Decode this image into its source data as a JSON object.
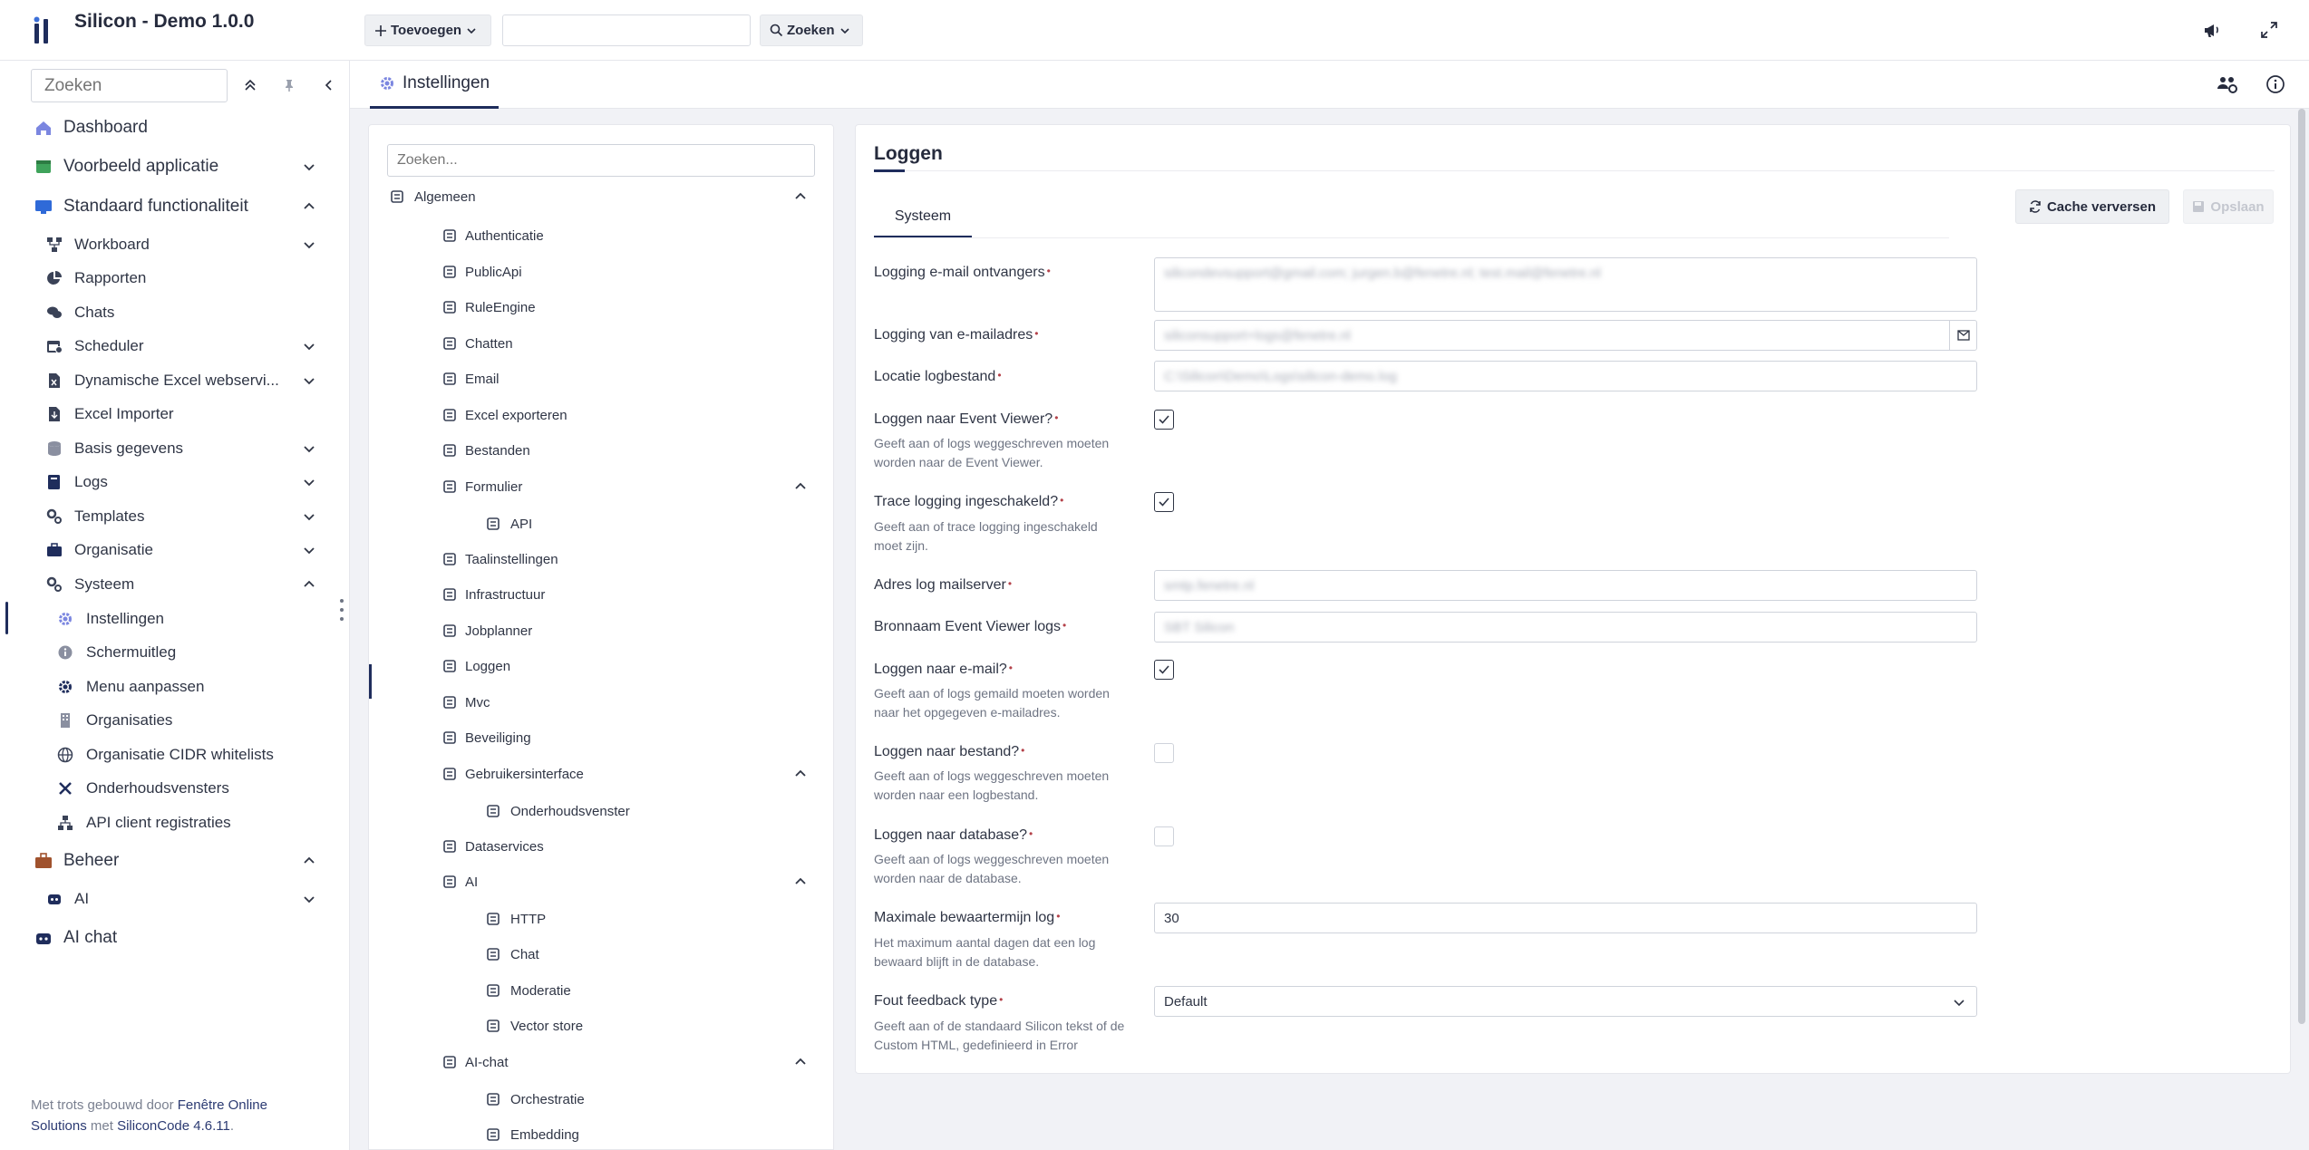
{
  "app": {
    "title": "Silicon - Demo 1.0.0"
  },
  "topbar": {
    "add_label": "Toevoegen",
    "search_label": "Zoeken",
    "search_value": ""
  },
  "sidebar": {
    "search_placeholder": "Zoeken",
    "items": [
      {
        "label": "Dashboard",
        "icon": "home-icon"
      },
      {
        "label": "Voorbeeld applicatie",
        "icon": "app-icon"
      },
      {
        "label": "Standaard functionaliteit",
        "icon": "monitor-icon"
      },
      {
        "label": "Workboard",
        "icon": "workflow-icon"
      },
      {
        "label": "Rapporten",
        "icon": "pie-chart-icon"
      },
      {
        "label": "Chats",
        "icon": "chat-icon"
      },
      {
        "label": "Scheduler",
        "icon": "calendar-icon"
      },
      {
        "label": "Dynamische Excel webservi...",
        "icon": "excel-icon"
      },
      {
        "label": "Excel Importer",
        "icon": "excel-import-icon"
      },
      {
        "label": "Basis gegevens",
        "icon": "database-icon"
      },
      {
        "label": "Logs",
        "icon": "book-icon"
      },
      {
        "label": "Templates",
        "icon": "templates-icon"
      },
      {
        "label": "Organisatie",
        "icon": "briefcase-icon"
      },
      {
        "label": "Systeem",
        "icon": "gears-icon"
      },
      {
        "label": "Instellingen",
        "icon": "gear-icon"
      },
      {
        "label": "Schermuitleg",
        "icon": "info-icon"
      },
      {
        "label": "Menu aanpassen",
        "icon": "gear-icon"
      },
      {
        "label": "Organisaties",
        "icon": "building-icon"
      },
      {
        "label": "Organisatie CIDR whitelists",
        "icon": "globe-icon"
      },
      {
        "label": "Onderhoudsvensters",
        "icon": "tools-icon"
      },
      {
        "label": "API client registraties",
        "icon": "sitemap-icon"
      },
      {
        "label": "Beheer",
        "icon": "briefcase-icon"
      },
      {
        "label": "AI",
        "icon": "robot-icon"
      },
      {
        "label": "AI chat",
        "icon": "robot-icon"
      }
    ],
    "footer": {
      "prefix": "Met trots gebouwd door ",
      "company": "Fenêtre Online Solutions",
      "middle": " met ",
      "product": "SiliconCode 4.6.11",
      "suffix": "."
    }
  },
  "page": {
    "tab_label": "Instellingen"
  },
  "tree": {
    "search_placeholder": "Zoeken...",
    "items": [
      {
        "label": "Algemeen",
        "icon": "list-icon"
      },
      {
        "label": "Authenticatie",
        "icon": "user-icon"
      },
      {
        "label": "PublicApi",
        "icon": "list-icon"
      },
      {
        "label": "RuleEngine",
        "icon": "list-icon"
      },
      {
        "label": "Chatten",
        "icon": "chat-icon"
      },
      {
        "label": "Email",
        "icon": "envelope-icon"
      },
      {
        "label": "Excel exporteren",
        "icon": "file-export-icon"
      },
      {
        "label": "Bestanden",
        "icon": "files-icon"
      },
      {
        "label": "Formulier",
        "icon": "list-icon"
      },
      {
        "label": "API",
        "icon": "v-icon"
      },
      {
        "label": "Taalinstellingen",
        "icon": "language-icon"
      },
      {
        "label": "Infrastructuur",
        "icon": "cloud-icon"
      },
      {
        "label": "Jobplanner",
        "icon": "calendar-icon"
      },
      {
        "label": "Loggen",
        "icon": "list-icon"
      },
      {
        "label": "Mvc",
        "icon": "share-icon"
      },
      {
        "label": "Beveiliging",
        "icon": "shield-icon"
      },
      {
        "label": "Gebruikersinterface",
        "icon": "monitor-icon"
      },
      {
        "label": "Onderhoudsvenster",
        "icon": "tools-icon"
      },
      {
        "label": "Dataservices",
        "icon": "database-icon"
      },
      {
        "label": "AI",
        "icon": "globe-icon"
      },
      {
        "label": "HTTP",
        "icon": "globe-icon"
      },
      {
        "label": "Chat",
        "icon": "chat-icon"
      },
      {
        "label": "Moderatie",
        "icon": "shield-icon"
      },
      {
        "label": "Vector store",
        "icon": "vector-icon"
      },
      {
        "label": "AI-chat",
        "icon": "chat-icon"
      },
      {
        "label": "Orchestratie",
        "icon": "sitemap-icon"
      },
      {
        "label": "Embedding",
        "icon": "vector-icon"
      }
    ]
  },
  "panel": {
    "title": "Loggen",
    "tab": "Systeem",
    "cache_button": "Cache verversen",
    "save_button": "Opslaan",
    "fields": {
      "email_receivers": {
        "label": "Logging e-mail ontvangers",
        "value": "silicondevsupport@gmail.com; jurgen.b@fenetre.nl; test.mail@fenetre.nl"
      },
      "email_from": {
        "label": "Logging van e-mailadres",
        "value": "siliconsupport+logs@fenetre.nl"
      },
      "log_location": {
        "label": "Locatie logbestand",
        "value": "C:\\Silicon\\Demo\\Logs\\silicon-demo.log"
      },
      "event_viewer": {
        "label": "Loggen naar Event Viewer?",
        "help": "Geeft aan of logs weggeschreven moeten worden naar de Event Viewer.",
        "checked": true
      },
      "trace": {
        "label": "Trace logging ingeschakeld?",
        "help": "Geeft aan of trace logging ingeschakeld moet zijn.",
        "checked": true
      },
      "mailserver": {
        "label": "Adres log mailserver",
        "value": "smtp.fenetre.nl"
      },
      "event_source": {
        "label": "Bronnaam Event Viewer logs",
        "value": "SBT Silicon"
      },
      "log_email": {
        "label": "Loggen naar e-mail?",
        "help": "Geeft aan of logs gemaild moeten worden naar het opgegeven e-mailadres.",
        "checked": true
      },
      "log_file": {
        "label": "Loggen naar bestand?",
        "help": "Geeft aan of logs weggeschreven moeten worden naar een logbestand.",
        "checked": false
      },
      "log_db": {
        "label": "Loggen naar database?",
        "help": "Geeft aan of logs weggeschreven moeten worden naar de database.",
        "checked": false
      },
      "retention": {
        "label": "Maximale bewaartermijn log",
        "help": "Het maximum aantal dagen dat een log bewaard blijft in de database.",
        "value": "30"
      },
      "feedback": {
        "label": "Fout feedback type",
        "help": "Geeft aan of de standaard Silicon tekst of de Custom HTML, gedefinieerd in Error",
        "value": "Default"
      }
    }
  },
  "colors": {
    "accent": "#1f2d5c",
    "background": "#f1f2f6",
    "required": "#b4424a"
  }
}
